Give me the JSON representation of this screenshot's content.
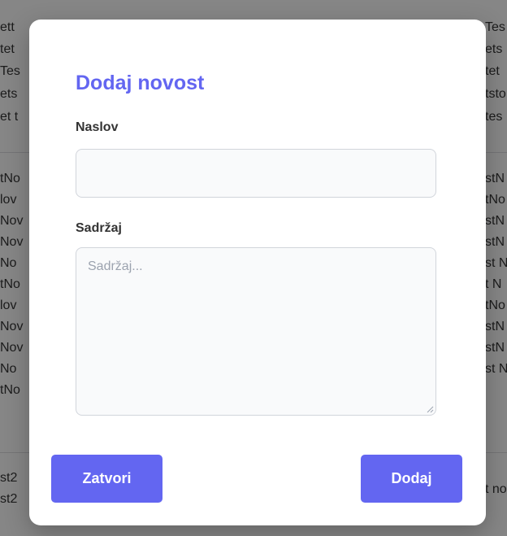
{
  "background": {
    "left_fragments": [
      "ett",
      "tet",
      "Tes",
      "ets",
      "et t",
      "tNo",
      "lov",
      "Nov",
      "Nov",
      "No",
      "tNo",
      "lov",
      "Nov",
      "Nov",
      "No",
      "tNo",
      "st2",
      "st2"
    ],
    "right_fragments": [
      "Tes",
      "ets",
      "tet",
      "tsto",
      "tes",
      "stN",
      "tNo",
      "stN",
      "stN",
      "st N",
      "t N",
      "tNo",
      "stN",
      "stN",
      "st N",
      "t no"
    ]
  },
  "modal": {
    "title": "Dodaj novost",
    "title_label": "Naslov",
    "title_value": "",
    "content_label": "Sadržaj",
    "content_placeholder": "Sadržaj...",
    "close_button": "Zatvori",
    "add_button": "Dodaj"
  },
  "colors": {
    "accent": "#6366f1",
    "overlay": "rgba(0,0,0,0.45)",
    "field_bg": "#f9fafb"
  }
}
